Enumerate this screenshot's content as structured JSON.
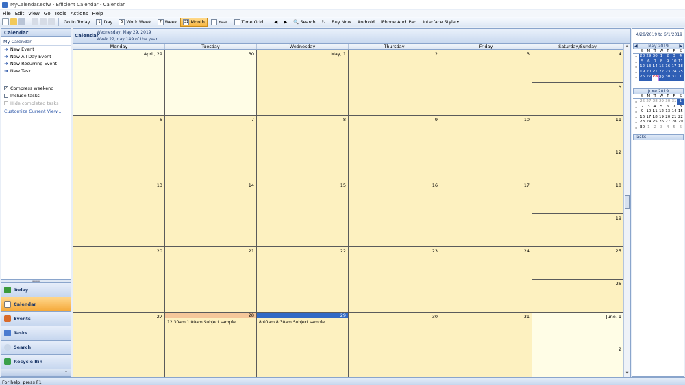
{
  "window": {
    "title": "MyCalendar.ecfw - Efficient Calendar - Calendar"
  },
  "menu": [
    "File",
    "Edit",
    "View",
    "Go",
    "Tools",
    "Actions",
    "Help"
  ],
  "toolbar": {
    "go_today": "Go to Today",
    "day": "Day",
    "work_week": "Work Week",
    "week": "Week",
    "month": "Month",
    "year": "Year",
    "time_grid": "Time Grid",
    "search": "Search",
    "buy_now": "Buy Now",
    "android": "Android",
    "iphone": "iPhone And iPad",
    "interface_style": "Interface Style"
  },
  "left_pane": {
    "header": "Calendar",
    "sub": "My Calendar",
    "tasks": [
      "New Event",
      "New All Day Event",
      "New Recurring Event",
      "New Task"
    ],
    "options": [
      {
        "label": "Compress weekend",
        "checked": true,
        "disabled": false
      },
      {
        "label": "Include tasks",
        "checked": false,
        "disabled": false
      },
      {
        "label": "Hide completed tasks",
        "checked": false,
        "disabled": true
      }
    ],
    "customize": "Customize Current View...",
    "nav": [
      "Today",
      "Calendar",
      "Events",
      "Tasks",
      "Search",
      "Recycle Bin"
    ],
    "nav_active": "Calendar"
  },
  "main": {
    "title": "Calendar",
    "date_line": "Wednesday, May 29, 2019",
    "week_line": "Week 22, day 149 of the year",
    "range": "4/28/2019 to 6/1/2019",
    "dow": [
      "Monday",
      "Tuesday",
      "Wednesday",
      "Thursday",
      "Friday",
      "Saturday/Sunday"
    ],
    "weeks": [
      {
        "days": [
          "April, 29",
          "30",
          "May, 1",
          "2",
          "3"
        ],
        "sat": "4",
        "sun": "5"
      },
      {
        "days": [
          "6",
          "7",
          "8",
          "9",
          "10"
        ],
        "sat": "11",
        "sun": "12"
      },
      {
        "days": [
          "13",
          "14",
          "15",
          "16",
          "17"
        ],
        "sat": "18",
        "sun": "19"
      },
      {
        "days": [
          "20",
          "21",
          "22",
          "23",
          "24"
        ],
        "sat": "25",
        "sun": "26"
      },
      {
        "days": [
          "27",
          "28",
          "29",
          "30",
          "31"
        ],
        "sat": "June, 1",
        "sun": "2"
      }
    ],
    "events": [
      {
        "week": 4,
        "day": 1,
        "text": "12:30am   1:00am Subject sample"
      },
      {
        "week": 4,
        "day": 2,
        "text": "8:00am   8:30am Subject sample"
      }
    ]
  },
  "mini_may": {
    "title": "May 2019",
    "dow": [
      "S",
      "M",
      "T",
      "W",
      "T",
      "F",
      "S"
    ],
    "rows": [
      [
        "28",
        "29",
        "30",
        "1",
        "2",
        "3",
        "4"
      ],
      [
        "5",
        "6",
        "7",
        "8",
        "9",
        "10",
        "11"
      ],
      [
        "12",
        "13",
        "14",
        "15",
        "16",
        "17",
        "18"
      ],
      [
        "19",
        "20",
        "21",
        "22",
        "23",
        "24",
        "25"
      ],
      [
        "26",
        "27",
        "28",
        "29",
        "30",
        "31",
        "1"
      ]
    ]
  },
  "mini_june": {
    "title": "June 2019",
    "dow": [
      "S",
      "M",
      "T",
      "W",
      "T",
      "F",
      "S"
    ],
    "rows": [
      [
        "26",
        "27",
        "28",
        "29",
        "30",
        "31",
        "1"
      ],
      [
        "2",
        "3",
        "4",
        "5",
        "6",
        "7",
        "8"
      ],
      [
        "9",
        "10",
        "11",
        "12",
        "13",
        "14",
        "15"
      ],
      [
        "16",
        "17",
        "18",
        "19",
        "20",
        "21",
        "22"
      ],
      [
        "23",
        "24",
        "25",
        "26",
        "27",
        "28",
        "29"
      ],
      [
        "30",
        "1",
        "2",
        "3",
        "4",
        "5",
        "6"
      ]
    ]
  },
  "tasks_header": "Tasks",
  "status": "For help, press F1"
}
